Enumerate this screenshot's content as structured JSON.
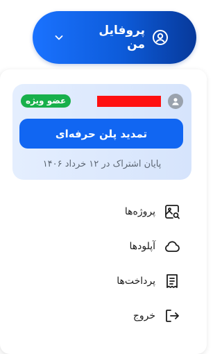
{
  "profile_button": {
    "label": "پروفایل من",
    "icon": "user-circle-icon",
    "chevron": "chevron-down-icon"
  },
  "plan_card": {
    "badge": "عضو ویژه",
    "avatar_icon": "user-avatar-icon",
    "renew_button": "تمدید پلن حرفه‌ای",
    "expiry": "پایان اشتراک در ۱۲ خرداد ۱۴۰۶"
  },
  "menu": {
    "items": [
      {
        "label": "پروژه‌ها",
        "icon": "image-search-icon"
      },
      {
        "label": "آپلودها",
        "icon": "cloud-icon"
      },
      {
        "label": "پرداخت‌ها",
        "icon": "receipt-icon"
      },
      {
        "label": "خروج",
        "icon": "logout-icon"
      }
    ]
  },
  "colors": {
    "primary": "#1166f2",
    "badge": "#18b04b",
    "redaction": "#ff1010"
  }
}
